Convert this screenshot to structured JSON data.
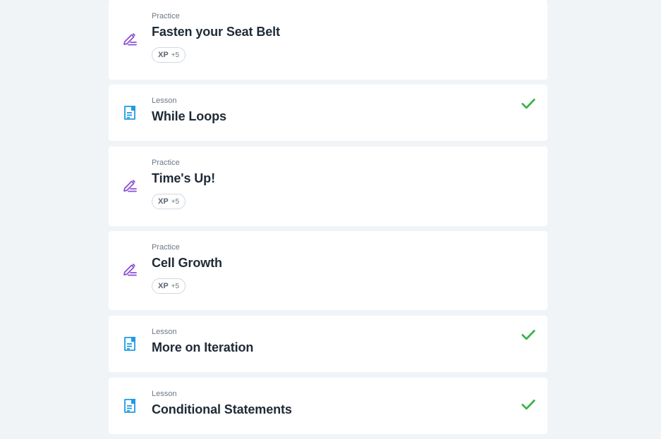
{
  "items": [
    {
      "type": "Practice",
      "title": "Fasten your Seat Belt",
      "xp_label": "XP",
      "xp_value": "+5",
      "icon": "pencil-icon",
      "completed": false
    },
    {
      "type": "Lesson",
      "title": "While Loops",
      "icon": "document-icon",
      "completed": true
    },
    {
      "type": "Practice",
      "title": "Time's Up!",
      "xp_label": "XP",
      "xp_value": "+5",
      "icon": "pencil-icon",
      "completed": false
    },
    {
      "type": "Practice",
      "title": "Cell Growth",
      "xp_label": "XP",
      "xp_value": "+5",
      "icon": "pencil-icon",
      "completed": false
    },
    {
      "type": "Lesson",
      "title": "More on Iteration",
      "icon": "document-icon",
      "completed": true
    },
    {
      "type": "Lesson",
      "title": "Conditional Statements",
      "icon": "document-icon",
      "completed": true
    }
  ],
  "colors": {
    "practice_icon": "#8a4fd6",
    "lesson_icon": "#1e9be6",
    "check": "#3bb24a",
    "background": "#f1f4f7",
    "card": "#ffffff"
  }
}
